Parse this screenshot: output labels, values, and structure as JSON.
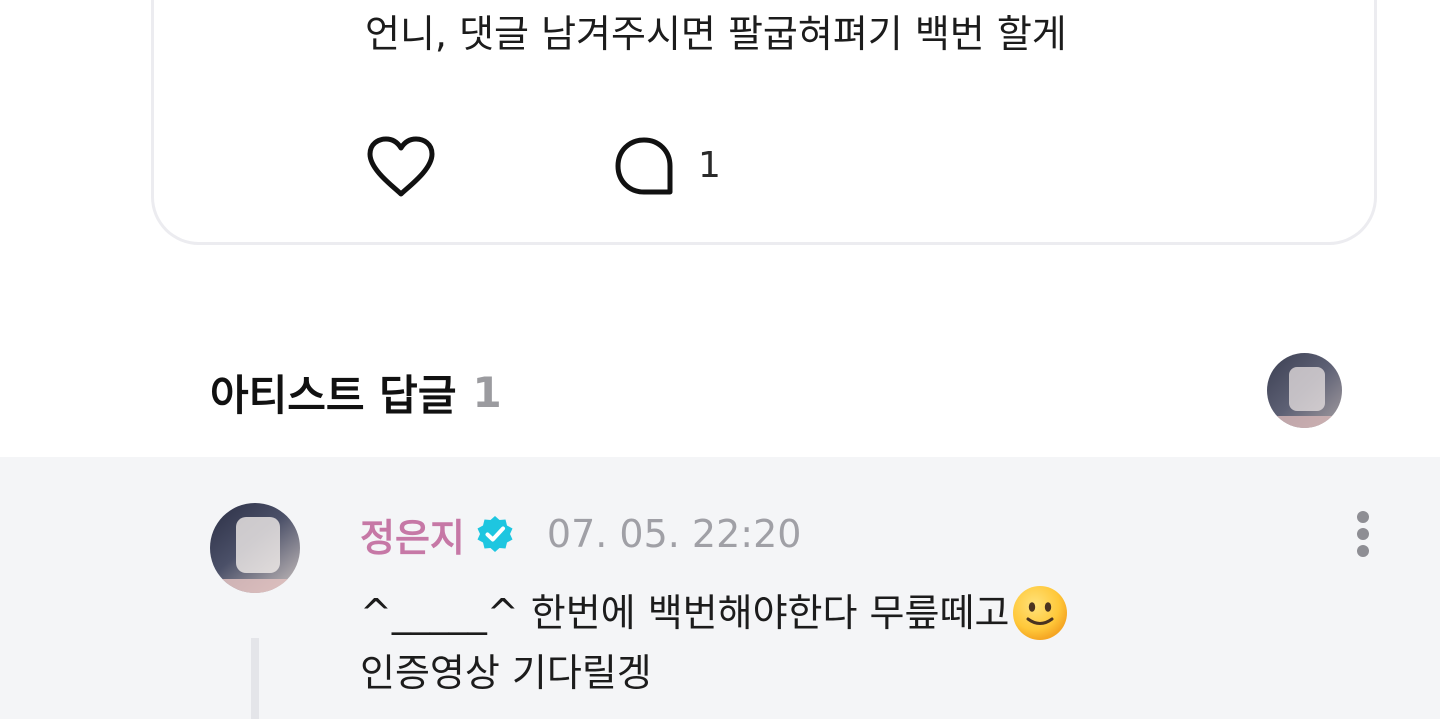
{
  "post": {
    "text": "언니, 댓글 남겨주시면 팔굽혀펴기 백번 할게",
    "comment_count": "1",
    "icons": [
      "heart-icon",
      "comment-bubble-icon"
    ]
  },
  "replies_header": {
    "title": "아티스트 답글",
    "count": "1"
  },
  "reply": {
    "author": "정은지",
    "verified_color": "#1ec6e0",
    "author_color": "#c678a6",
    "time": "07. 05. 22:20",
    "text_line1": "^_____^ 한번에 백번해야한다 무릎떼고",
    "text_line2": "인증영상 기다릴겡",
    "emoji": "slightly-smiling-face"
  }
}
